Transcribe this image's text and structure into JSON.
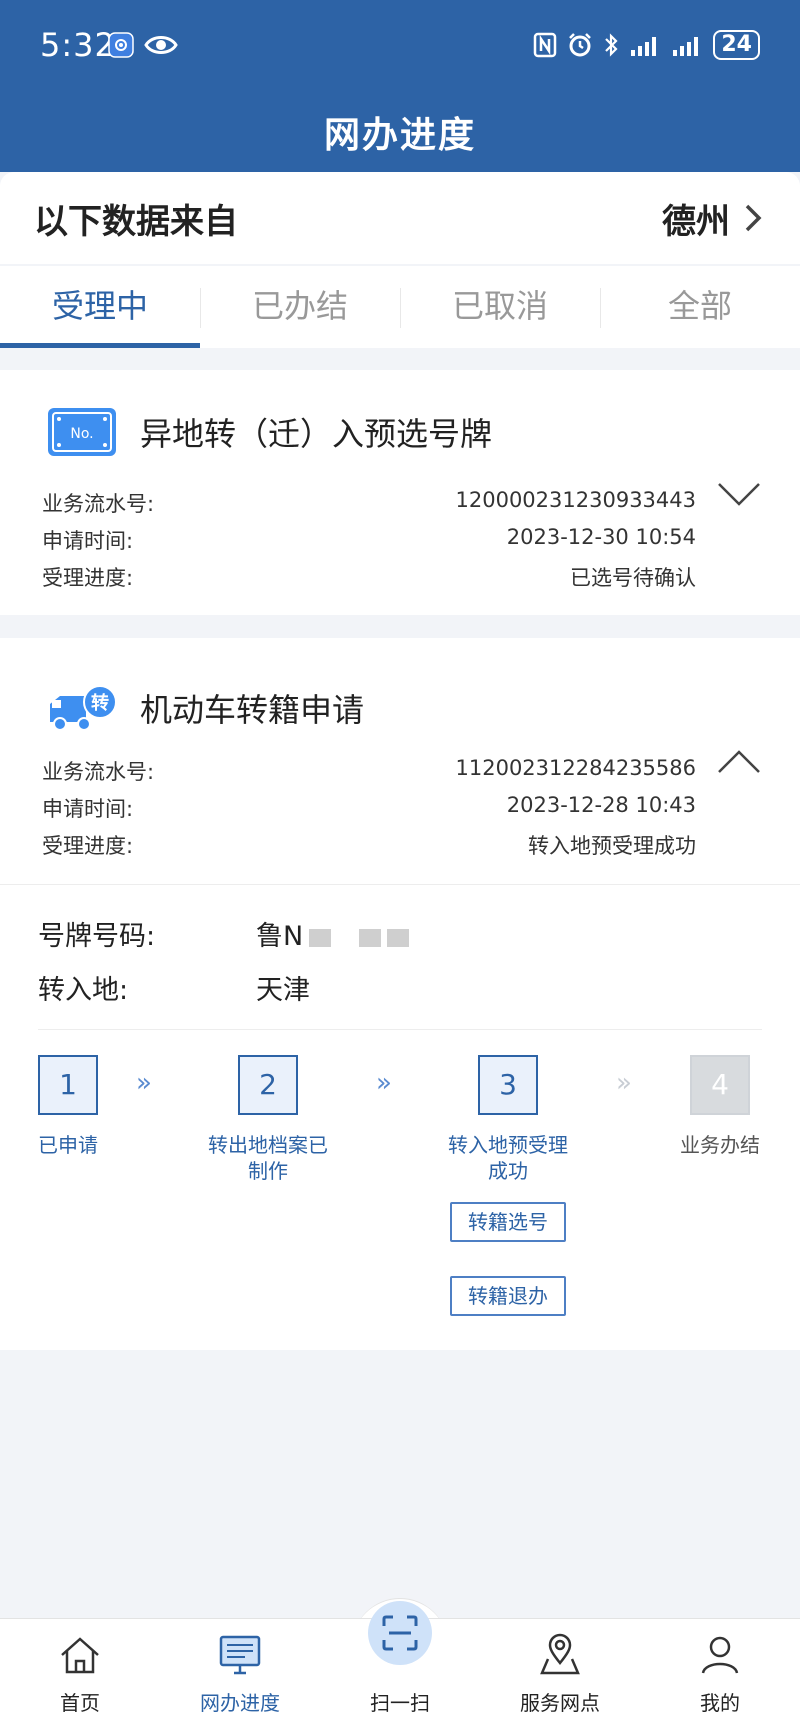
{
  "status": {
    "time": "5:32",
    "battery": "24"
  },
  "header": {
    "title": "网办进度"
  },
  "source": {
    "label": "以下数据来自",
    "city": "德州"
  },
  "tabs": [
    {
      "label": "受理中",
      "active": true
    },
    {
      "label": "已办结",
      "active": false
    },
    {
      "label": "已取消",
      "active": false
    },
    {
      "label": "全部",
      "active": false
    }
  ],
  "cards": [
    {
      "icon_text": "No.",
      "title": "异地转（迁）入预选号牌",
      "rows": [
        {
          "key": "业务流水号:",
          "value": "120000231230933443"
        },
        {
          "key": "申请时间:",
          "value": "2023-12-30 10:54"
        },
        {
          "key": "受理进度:",
          "value": "已选号待确认"
        }
      ],
      "expanded": false
    },
    {
      "icon_text": "转",
      "title": "机动车转籍申请",
      "rows": [
        {
          "key": "业务流水号:",
          "value": "112002312284235586"
        },
        {
          "key": "申请时间:",
          "value": "2023-12-28 10:43"
        },
        {
          "key": "受理进度:",
          "value": "转入地预受理成功"
        }
      ],
      "expanded": true,
      "detail": {
        "plate_label": "号牌号码:",
        "plate_value": "鲁N",
        "dest_label": "转入地:",
        "dest_value": "天津"
      },
      "steps": [
        {
          "num": "1",
          "label": "已申请",
          "done": true
        },
        {
          "num": "2",
          "label": "转出地档案已\n制作",
          "done": true
        },
        {
          "num": "3",
          "label": "转入地预受理\n成功",
          "done": true
        },
        {
          "num": "4",
          "label": "业务办结",
          "done": false
        }
      ],
      "step_arrow": "»",
      "actions": [
        "转籍选号",
        "转籍退办"
      ]
    }
  ],
  "bottom_nav": [
    {
      "label": "首页",
      "icon": "home-icon",
      "active": false
    },
    {
      "label": "网办进度",
      "icon": "monitor-icon",
      "active": true
    },
    {
      "label": "扫一扫",
      "icon": "scan-icon",
      "active": false
    },
    {
      "label": "服务网点",
      "icon": "map-pin-icon",
      "active": false
    },
    {
      "label": "我的",
      "icon": "user-icon",
      "active": false
    }
  ],
  "colors": {
    "brand": "#2d63a6",
    "background": "#f2f4f8"
  }
}
